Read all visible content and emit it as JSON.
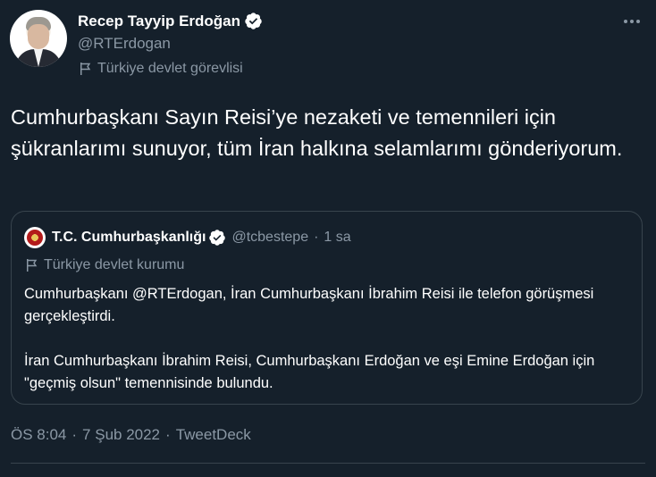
{
  "author": {
    "name": "Recep Tayyip Erdoğan",
    "handle": "@RTErdogan",
    "label": "Türkiye devlet görevlisi"
  },
  "tweet": {
    "text": "Cumhurbaşkanı Sayın Reisi’ye nezaketi ve temennileri için şükranlarımı sunuyor, tüm İran halkına selamlarımı gönderiyorum."
  },
  "quoted": {
    "name": "T.C. Cumhurbaşkanlığı",
    "handle": "@tcbestepe",
    "separator": "·",
    "time": "1 sa",
    "label": "Türkiye devlet kurumu",
    "paragraph1": "Cumhurbaşkanı @RTErdogan, İran Cumhurbaşkanı İbrahim Reisi ile telefon görüşmesi gerçekleştirdi.",
    "paragraph2": "İran Cumhurbaşkanı İbrahim Reisi, Cumhurbaşkanı Erdoğan ve eşi Emine Erdoğan için \"geçmiş olsun\" temennisinde bulundu."
  },
  "meta": {
    "time": "ÖS 8:04",
    "date": "7 Şub 2022",
    "source": "TweetDeck",
    "separator": "·"
  },
  "icons": {
    "verified": "verified-badge-icon",
    "flag": "flag-icon",
    "more": "more-options-icon"
  },
  "colors": {
    "background": "#15202b",
    "text": "#ffffff",
    "secondary": "#8b98a5",
    "border": "#38444d"
  }
}
